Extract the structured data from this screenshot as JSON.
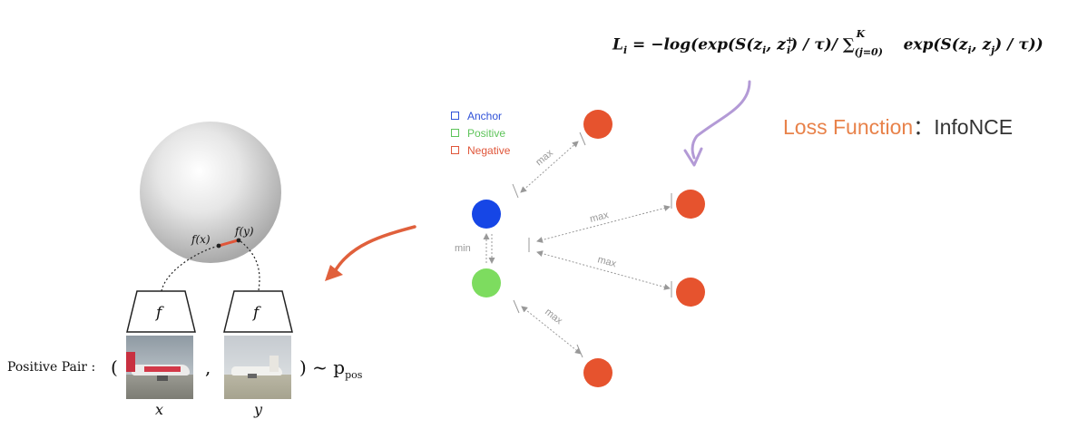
{
  "formula": {
    "lhs": "L",
    "lhs_sub": "i",
    "body_start": " = −log(exp(S(z",
    "zi_sub": "i",
    "comma": ", z",
    "zplus_sub": "i",
    "zplus_sup": "+",
    "mid": ") / τ)/ ∑",
    "sum_upper": "K",
    "sum_lower": "(j=0)",
    "tail_start": " exp(S(z",
    "tail_sub1": "i",
    "tail_comma": ", z",
    "tail_sub2": "j",
    "tail_end": ") / τ))"
  },
  "loss_function": {
    "label": "Loss Function",
    "separator": "：",
    "value": "InfoNCE"
  },
  "legend": [
    {
      "label": "Anchor",
      "color": "#2f51d8"
    },
    {
      "label": "Positive",
      "color": "#5ec45a"
    },
    {
      "label": "Negative",
      "color": "#e0563a"
    }
  ],
  "embedding": {
    "fx_label": "f(x)",
    "fy_label": "f(y)",
    "encoder_label_1": "f",
    "encoder_label_2": "f"
  },
  "edges": {
    "min_label": "min",
    "max_labels": [
      "max",
      "max",
      "max",
      "max"
    ]
  },
  "positive_pair": {
    "label": "Positive Pair :",
    "open_paren": "(",
    "comma": ",",
    "close": ") ~ p",
    "close_sub": "pos",
    "x_label": "x",
    "y_label": "y"
  },
  "colors": {
    "anchor": "#1646e6",
    "positive": "#7ddc5f",
    "negative": "#e6532e",
    "arrow_purple": "#b39ad6",
    "arrow_orange": "#e0603c"
  }
}
